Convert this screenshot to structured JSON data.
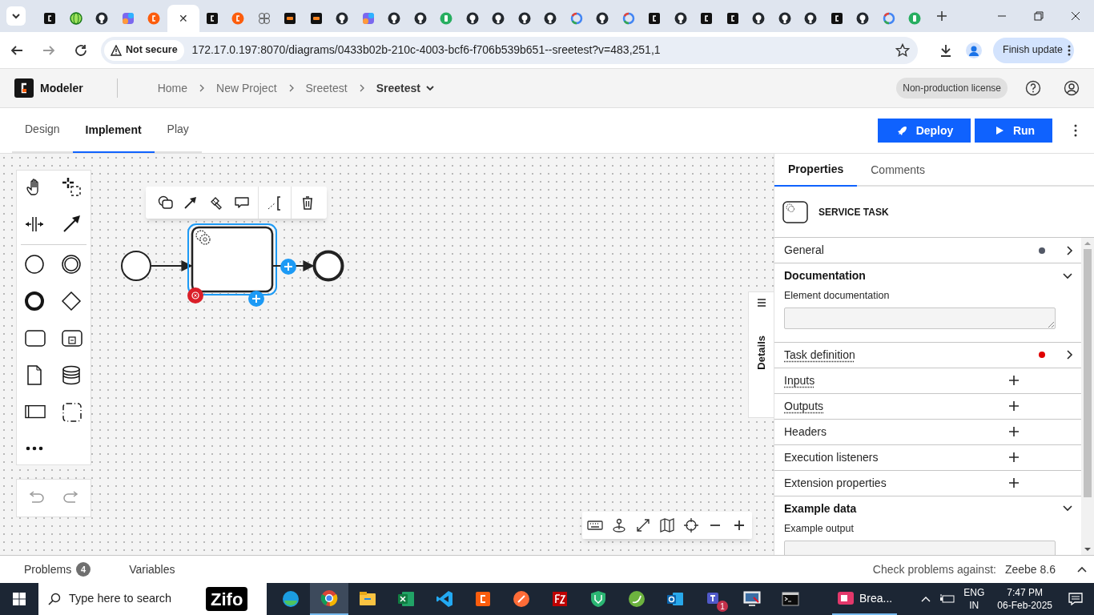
{
  "browser": {
    "tabs": [
      {
        "kind": "camunda",
        "selected": false
      },
      {
        "kind": "globe",
        "selected": false
      },
      {
        "kind": "github",
        "selected": false
      },
      {
        "kind": "copilot",
        "selected": false
      },
      {
        "kind": "camunda-orange",
        "selected": false
      },
      {
        "selected": true,
        "close": "✕"
      },
      {
        "kind": "camunda",
        "selected": false
      },
      {
        "kind": "camunda-orange",
        "selected": false
      },
      {
        "kind": "grid",
        "selected": false
      },
      {
        "kind": "chat",
        "selected": false
      },
      {
        "kind": "chat",
        "selected": false
      },
      {
        "kind": "github",
        "selected": false
      },
      {
        "kind": "copilot",
        "selected": false
      },
      {
        "kind": "github",
        "selected": false
      },
      {
        "kind": "github",
        "selected": false
      },
      {
        "kind": "bolt",
        "selected": false
      },
      {
        "kind": "github",
        "selected": false
      },
      {
        "kind": "github",
        "selected": false
      },
      {
        "kind": "github",
        "selected": false
      },
      {
        "kind": "github",
        "selected": false
      },
      {
        "kind": "google",
        "selected": false
      },
      {
        "kind": "github",
        "selected": false
      },
      {
        "kind": "google",
        "selected": false
      },
      {
        "kind": "camunda",
        "selected": false
      },
      {
        "kind": "github",
        "selected": false
      },
      {
        "kind": "camunda",
        "selected": false
      },
      {
        "kind": "camunda",
        "selected": false
      },
      {
        "kind": "github",
        "selected": false
      },
      {
        "kind": "github",
        "selected": false
      },
      {
        "kind": "github",
        "selected": false
      },
      {
        "kind": "camunda",
        "selected": false
      },
      {
        "kind": "github",
        "selected": false
      },
      {
        "kind": "google",
        "selected": false
      },
      {
        "kind": "bolt",
        "selected": false
      }
    ],
    "security": "Not secure",
    "url": "172.17.0.197:8070/diagrams/0433b02b-210c-4003-bcf6-f706b539b651--sreetest?v=483,251,1",
    "update_button": "Finish update"
  },
  "app": {
    "name": "Modeler",
    "breadcrumbs": [
      "Home",
      "New Project",
      "Sreetest",
      "Sreetest"
    ],
    "license": "Non-production license"
  },
  "mode_tabs": [
    {
      "label": "Design",
      "selected": false
    },
    {
      "label": "Implement",
      "selected": true
    },
    {
      "label": "Play",
      "selected": false
    }
  ],
  "actions": [
    {
      "label": "Deploy",
      "kind": "deploy"
    },
    {
      "label": "Run",
      "kind": "run"
    }
  ],
  "details_tab": "Details",
  "properties": {
    "tabs": [
      {
        "label": "Properties",
        "selected": true
      },
      {
        "label": "Comments",
        "selected": false
      }
    ],
    "element_type": "SERVICE TASK",
    "groups": [
      {
        "label": "General",
        "kind": "collapsed",
        "color": "#525866",
        "dotted_underline": false
      },
      {
        "label": "Documentation",
        "kind": "expanded",
        "field": "Element documentation",
        "resize_handle": true,
        "dotted_underline": false
      },
      {
        "label": "Task definition",
        "kind": "collapsed",
        "color": "#e00000",
        "dotted_underline": true
      },
      {
        "label": "Inputs",
        "kind": "addable",
        "dotted_underline": true
      },
      {
        "label": "Outputs",
        "kind": "addable",
        "dotted_underline": true
      },
      {
        "label": "Headers",
        "kind": "addable",
        "dotted_underline": false
      },
      {
        "label": "Execution listeners",
        "kind": "addable",
        "dotted_underline": false
      },
      {
        "label": "Extension properties",
        "kind": "addable",
        "dotted_underline": false
      },
      {
        "label": "Example data",
        "kind": "expanded",
        "field": "Example output",
        "dotted_underline": false
      }
    ]
  },
  "bottom": {
    "problems": "Problems",
    "problem_count": "4",
    "variables": "Variables",
    "check_label": "Check problems against:",
    "engine": "Zeebe 8.6"
  },
  "taskbar": {
    "search_placeholder": "Type here to search",
    "logo": "Zifo",
    "apps": [
      {
        "kind": "edge",
        "selected": false
      },
      {
        "kind": "chrome",
        "selected": true
      },
      {
        "kind": "explorer",
        "selected": false
      },
      {
        "kind": "excel",
        "selected": false
      },
      {
        "kind": "vscode",
        "selected": false
      },
      {
        "kind": "camunda",
        "selected": false
      },
      {
        "kind": "postman",
        "selected": false
      },
      {
        "kind": "filezilla",
        "selected": false
      },
      {
        "kind": "shield",
        "selected": false
      },
      {
        "kind": "spring",
        "selected": false
      },
      {
        "kind": "outlook",
        "selected": false
      },
      {
        "kind": "teams",
        "selected": false,
        "badge": "1"
      },
      {
        "kind": "remote",
        "selected": false
      },
      {
        "kind": "terminal",
        "selected": false
      }
    ],
    "running_app": "Brea...",
    "language": "ENG",
    "region": "IN",
    "time": "7:47 PM",
    "date": "06-Feb-2025"
  }
}
